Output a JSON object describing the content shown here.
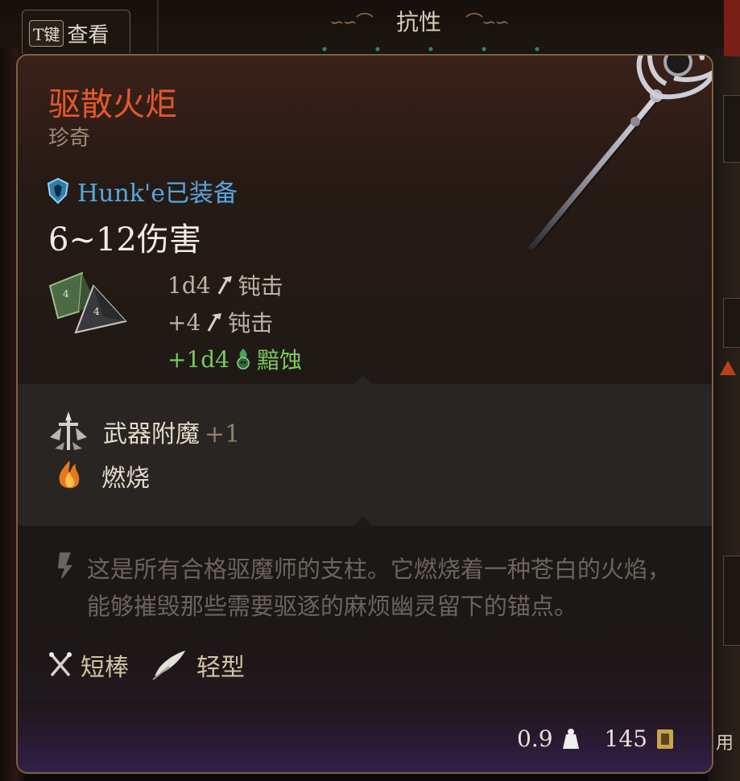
{
  "background": {
    "view_button": {
      "key": "T键",
      "label": "查看"
    },
    "top_title": "抗性",
    "use_label": "用"
  },
  "item": {
    "name": "驱散火炬",
    "rarity": "珍奇",
    "equipped": "Hunk'e已装备",
    "damage": "6~12伤害",
    "damage_rolls": [
      {
        "dice": "1d4",
        "type": "钝击",
        "icon": "bludgeon-icon",
        "color": "#bfb3a6"
      },
      {
        "dice": "+4",
        "type": "钝击",
        "icon": "bludgeon-icon",
        "color": "#bfb3a6"
      },
      {
        "dice": "+1d4",
        "type": "黯蚀",
        "icon": "necrotic-icon",
        "color": "#79c95c"
      }
    ],
    "enchantment": {
      "label": "武器附魔",
      "bonus": "+1"
    },
    "special": "燃烧",
    "description": "这是所有合格驱魔师的支柱。它燃烧着一种苍白的火焰，能够摧毁那些需要驱逐的麻烦幽灵留下的锚点。",
    "properties": [
      {
        "label": "短棒",
        "icon": "crossed-clubs-icon"
      },
      {
        "label": "轻型",
        "icon": "feather-icon"
      }
    ],
    "weight": "0.9",
    "price": "145"
  },
  "colors": {
    "name": "#e3582b",
    "equipped": "#55a7dc",
    "necrotic": "#79c95c",
    "property": "#d3c3a3"
  }
}
